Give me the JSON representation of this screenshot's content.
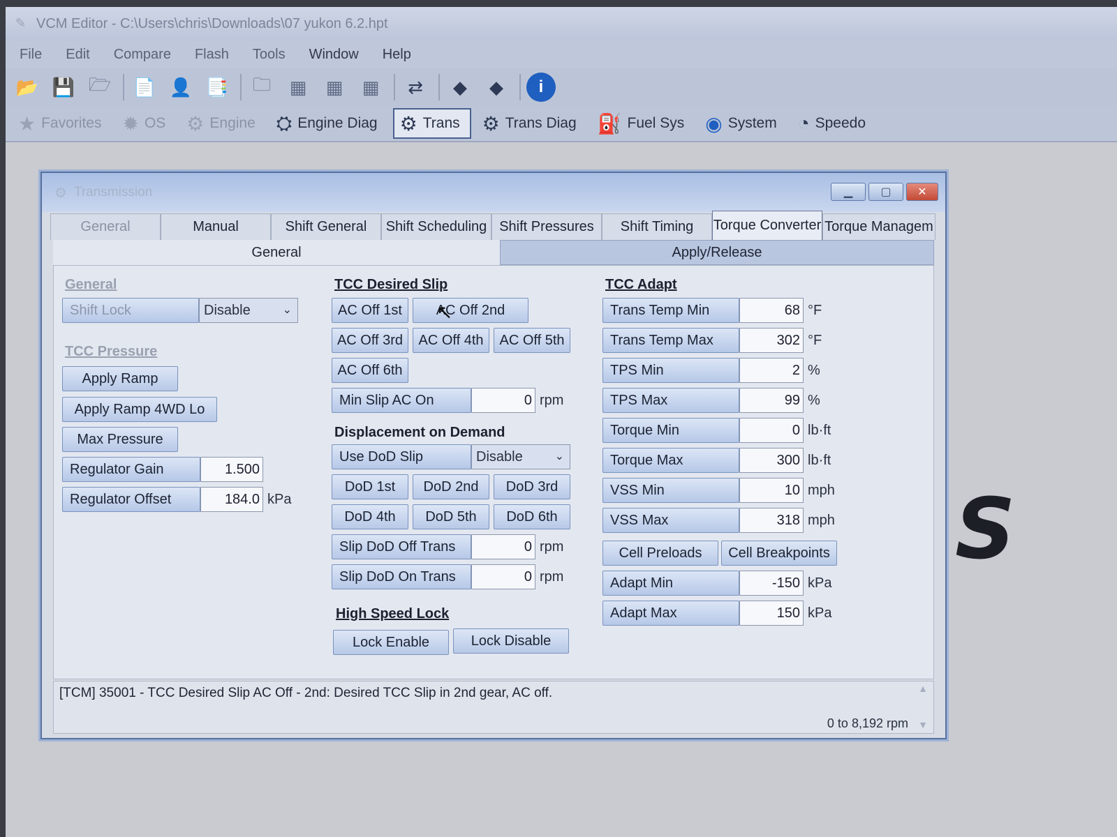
{
  "app": {
    "title": "VCM Editor - C:\\Users\\chris\\Downloads\\07 yukon 6.2.hpt",
    "menu": [
      "File",
      "Edit",
      "Compare",
      "Flash",
      "Tools",
      "Window",
      "Help"
    ]
  },
  "toolbar_icons": [
    "open-icon",
    "save-icon",
    "folder-icon",
    "file-info-icon",
    "user-icon",
    "file-compare-icon",
    "folder-image-icon",
    "table-icon",
    "table-icon",
    "table-icon",
    "swap-icon",
    "chip-icon",
    "chip-icon",
    "info-icon"
  ],
  "modules": [
    {
      "label": "Favorites",
      "icon": "star-icon",
      "enabled": false
    },
    {
      "label": "OS",
      "icon": "chip-icon",
      "enabled": false
    },
    {
      "label": "Engine",
      "icon": "engine-icon",
      "enabled": false
    },
    {
      "label": "Engine Diag",
      "icon": "engine-diag-icon",
      "enabled": true
    },
    {
      "label": "Trans",
      "icon": "gear-icon",
      "enabled": true,
      "selected": true
    },
    {
      "label": "Trans Diag",
      "icon": "gear-icon",
      "enabled": true
    },
    {
      "label": "Fuel Sys",
      "icon": "fuel-icon",
      "enabled": true
    },
    {
      "label": "System",
      "icon": "globe-icon",
      "enabled": true
    },
    {
      "label": "Speedo",
      "icon": "speedometer-icon",
      "enabled": true
    }
  ],
  "window": {
    "title": "Transmission",
    "tabs": [
      "General",
      "Manual",
      "Shift General",
      "Shift Scheduling",
      "Shift Pressures",
      "Shift Timing",
      "Torque Converter",
      "Torque Managem"
    ],
    "subtabs": [
      "General",
      "Apply/Release"
    ]
  },
  "general": {
    "heading": "General",
    "shift_lock_label": "Shift Lock",
    "shift_lock_value": "Disable"
  },
  "tcc_pressure": {
    "heading": "TCC Pressure",
    "apply_ramp": "Apply Ramp",
    "apply_ramp_4wd": "Apply Ramp 4WD Lo",
    "max_pressure": "Max Pressure",
    "regulator_gain_label": "Regulator Gain",
    "regulator_gain_value": "1.500",
    "regulator_offset_label": "Regulator Offset",
    "regulator_offset_value": "184.0",
    "regulator_offset_unit": "kPa"
  },
  "tcc_desired_slip": {
    "heading": "TCC Desired Slip",
    "buttons": [
      "AC Off 1st",
      "AC Off 2nd",
      "AC Off 3rd",
      "AC Off 4th",
      "AC Off 5th",
      "AC Off 6th"
    ],
    "min_slip_label": "Min Slip AC On",
    "min_slip_value": "0",
    "min_slip_unit": "rpm"
  },
  "dod": {
    "heading": "Displacement on Demand",
    "use_dod_label": "Use DoD Slip",
    "use_dod_value": "Disable",
    "buttons": [
      "DoD 1st",
      "DoD 2nd",
      "DoD 3rd",
      "DoD 4th",
      "DoD 5th",
      "DoD 6th"
    ],
    "slip_off_label": "Slip DoD Off Trans",
    "slip_off_value": "0",
    "slip_on_label": "Slip DoD On Trans",
    "slip_on_value": "0",
    "unit": "rpm"
  },
  "high_speed_lock": {
    "heading": "High Speed Lock",
    "lock_enable": "Lock Enable",
    "lock_disable": "Lock Disable"
  },
  "tcc_adapt": {
    "heading": "TCC Adapt",
    "rows": [
      {
        "label": "Trans Temp Min",
        "value": "68",
        "unit": "°F"
      },
      {
        "label": "Trans Temp Max",
        "value": "302",
        "unit": "°F"
      },
      {
        "label": "TPS Min",
        "value": "2",
        "unit": "%"
      },
      {
        "label": "TPS Max",
        "value": "99",
        "unit": "%"
      },
      {
        "label": "Torque Min",
        "value": "0",
        "unit": "lb·ft"
      },
      {
        "label": "Torque Max",
        "value": "300",
        "unit": "lb·ft"
      },
      {
        "label": "VSS Min",
        "value": "10",
        "unit": "mph"
      },
      {
        "label": "VSS Max",
        "value": "318",
        "unit": "mph"
      }
    ],
    "cell_preloads": "Cell Preloads",
    "cell_breakpoints": "Cell Breakpoints",
    "adapt_rows": [
      {
        "label": "Adapt Min",
        "value": "-150",
        "unit": "kPa"
      },
      {
        "label": "Adapt Max",
        "value": "150",
        "unit": "kPa"
      }
    ]
  },
  "status": {
    "message": "[TCM] 35001 - TCC Desired Slip AC Off - 2nd: Desired TCC Slip in 2nd gear, AC off.",
    "range": "0 to 8,192 rpm"
  },
  "background_text": "S"
}
